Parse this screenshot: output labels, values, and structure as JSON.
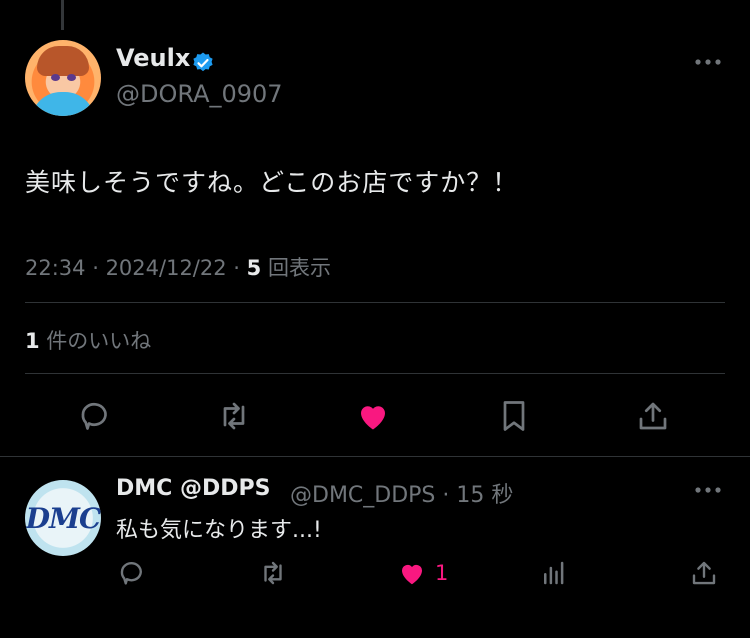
{
  "main_tweet": {
    "author_name": "Veulx",
    "author_handle": "@DORA_0907",
    "text": "美味しそうですね。どこのお店ですか？！",
    "time": "22:34",
    "sep1": " · ",
    "date": "2024/12/22",
    "sep2": " · ",
    "views_count": "5",
    "views_label": " 回表示",
    "likes_count": "1",
    "likes_label": " 件のいいね"
  },
  "reply": {
    "author_name": "DMC @DDPS",
    "author_handle": "@DMC_DDPS",
    "sep": " · ",
    "time_ago": "15 秒",
    "text": "私も気になります...!",
    "avatar_text": "DMC",
    "like_count": "1"
  },
  "icons": {
    "verified": "verified-badge-icon",
    "more": "more-icon",
    "reply": "reply-icon",
    "retweet": "retweet-icon",
    "like": "heart-icon",
    "bookmark": "bookmark-icon",
    "share": "share-icon",
    "analytics": "analytics-icon"
  },
  "colors": {
    "background": "#000000",
    "text_primary": "#e7e9ea",
    "text_secondary": "#71767b",
    "divider": "#2f3336",
    "like_pink": "#f91880",
    "verified_blue": "#1d9bf0"
  }
}
